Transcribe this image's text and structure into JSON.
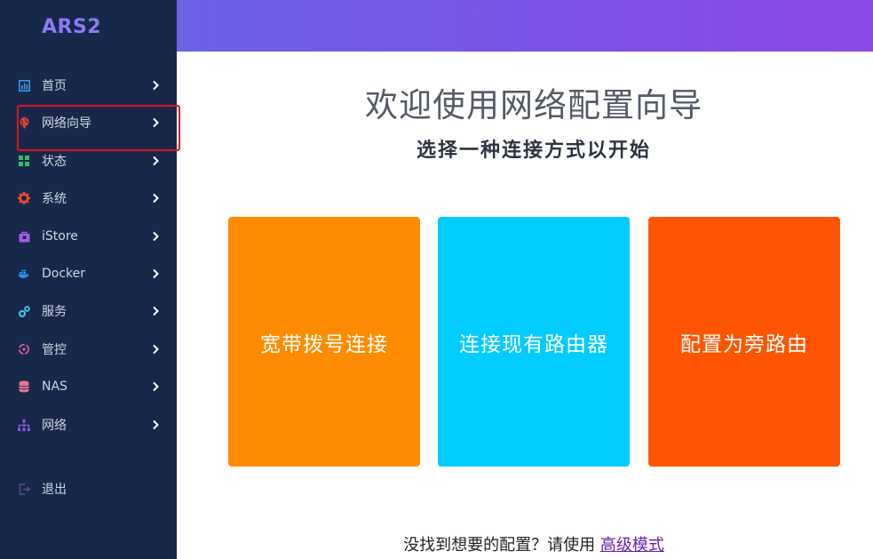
{
  "sidebar": {
    "logo": "ARS2",
    "items": [
      {
        "label": "首页",
        "icon": "dashboard-icon",
        "color": "#3aa0e8"
      },
      {
        "label": "网络向导",
        "icon": "globe-icon",
        "color": "#e0452e"
      },
      {
        "label": "状态",
        "icon": "grid-icon",
        "color": "#2fc06b"
      },
      {
        "label": "系统",
        "icon": "gear-icon",
        "color": "#ee4a2a"
      },
      {
        "label": "iStore",
        "icon": "store-icon",
        "color": "#a65be6"
      },
      {
        "label": "Docker",
        "icon": "docker-icon",
        "color": "#2496ed"
      },
      {
        "label": "服务",
        "icon": "services-icon",
        "color": "#3ccbe0"
      },
      {
        "label": "管控",
        "icon": "control-icon",
        "color": "#f060a0"
      },
      {
        "label": "NAS",
        "icon": "database-icon",
        "color": "#f07090"
      },
      {
        "label": "网络",
        "icon": "network-icon",
        "color": "#8a5be8"
      }
    ],
    "logout": {
      "label": "退出",
      "icon": "logout-icon",
      "color": "#6a4a8a"
    }
  },
  "main": {
    "title": "欢迎使用网络配置向导",
    "subtitle": "选择一种连接方式以开始",
    "cards": [
      {
        "label": "宽带拨号连接",
        "color": "#ff8c00"
      },
      {
        "label": "连接现有路由器",
        "color": "#00ccff"
      },
      {
        "label": "配置为旁路由",
        "color": "#ff5500"
      }
    ],
    "footer_text": "没找到想要的配置？请使用",
    "footer_link": "高级模式"
  },
  "colors": {
    "sidebar_bg": "#17284a",
    "header_gradient_start": "#6b62e6",
    "header_gradient_end": "#8b47e8",
    "highlight_border": "#e01414"
  }
}
